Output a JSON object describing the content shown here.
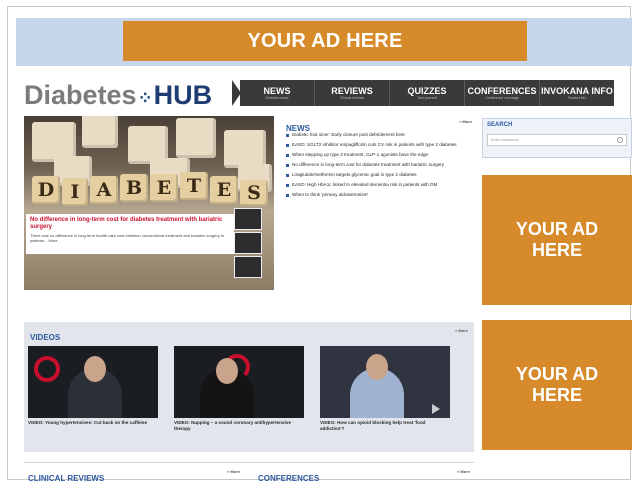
{
  "ads": {
    "top_label": "YOUR AD HERE",
    "side_1_label": "YOUR AD HERE",
    "side_2_label": "YOUR AD HERE",
    "color": "#d78a2a"
  },
  "logo": {
    "part1": "Diabetes",
    "part2": "HUB"
  },
  "nav": [
    {
      "label": "NEWS",
      "sub": "Diabetes news"
    },
    {
      "label": "REVIEWS",
      "sub": "Clinical reviews"
    },
    {
      "label": "QUIZZES",
      "sub": "Test yourself"
    },
    {
      "label": "CONFERENCES",
      "sub": "Conference coverage"
    },
    {
      "label": "INVOKANA INFO",
      "sub": "Product info"
    }
  ],
  "hero": {
    "tiles": [
      "D",
      "I",
      "A",
      "B",
      "E",
      "T",
      "E",
      "S"
    ],
    "title": "No difference in long-term cost for diabetes treatment with bariatric surgery",
    "text": "There was no difference in long-term health care cost between conventional treatment and bariatric surgery in patients... More"
  },
  "news": {
    "title": "NEWS",
    "more": "» More",
    "items": [
      "Diabetic foot ulcer: Early closure post debridement best",
      "EASD: SGLT2 inhibitor empagliflozin cuts CV risk in patients with type 2 diabetes",
      "When stepping up type 2 treatment, GLP-1 agonists have the edge",
      "No difference in long-term cost for diabetes treatment with bariatric surgery",
      "Liraglutide/metformin targets glycemic goal in type 2 diabetes",
      "EASD: High HbA1c linked to elevated dementia risk in patients with DM",
      "When to think 'primary aldosteronism'"
    ]
  },
  "search": {
    "title": "SEARCH",
    "placeholder": "Enter keywords"
  },
  "videos": {
    "title": "VIDEOS",
    "more": "» More",
    "items": [
      "VIDEO: Young hypertensives: Cut back on the caffeine",
      "VIDEO: Napping – a sound coronary antihypertensive therapy",
      "VIDEO: How can opioid blocking help treat 'food addiction'?"
    ]
  },
  "clinical_reviews": {
    "title": "CLINICAL REVIEWS",
    "more": "» More"
  },
  "conferences": {
    "title": "CONFERENCES",
    "more": "» More"
  }
}
